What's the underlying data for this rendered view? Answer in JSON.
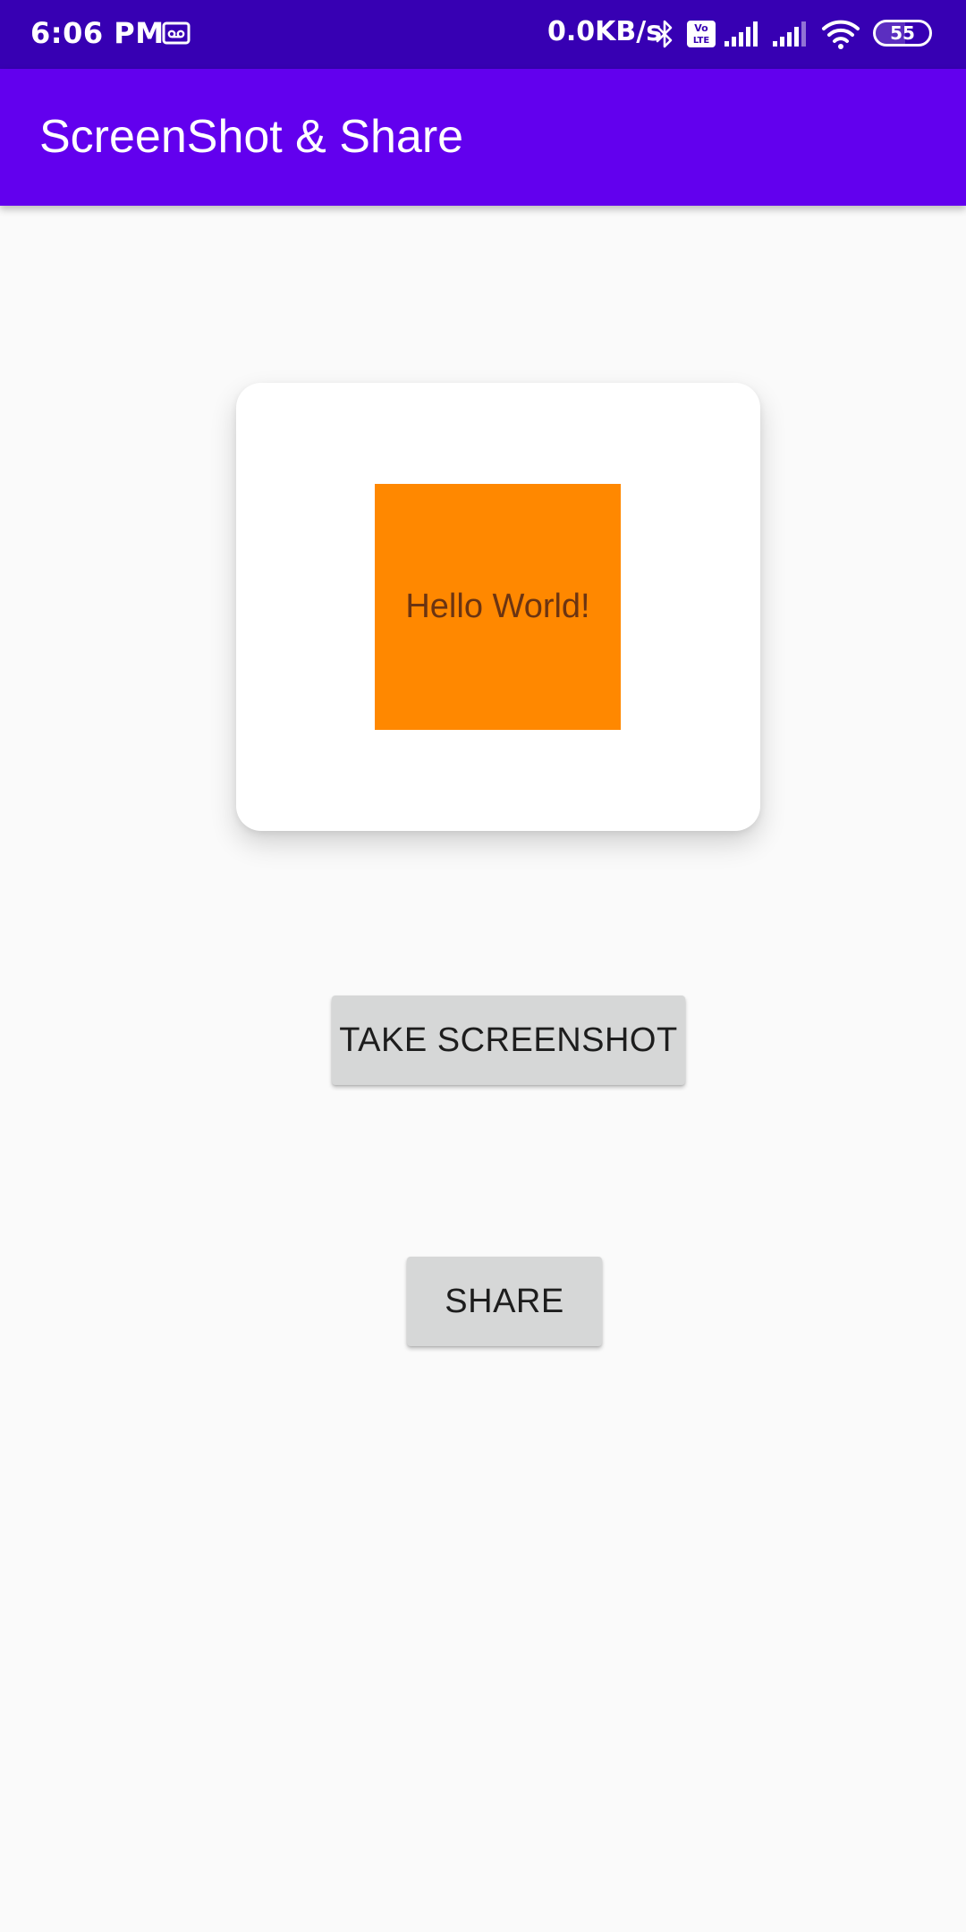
{
  "status_bar": {
    "time": "6:06 PM",
    "network_speed": "0.0KB/s",
    "battery_level": "55",
    "battery_fraction": 0.55,
    "icons": [
      "voicemail-icon",
      "bluetooth-icon",
      "volte-icon",
      "signal-icon",
      "signal-icon",
      "wifi-icon",
      "battery-icon"
    ]
  },
  "app_bar": {
    "title": "ScreenShot & Share"
  },
  "card": {
    "text": "Hello World!"
  },
  "buttons": {
    "take_screenshot": "TAKE SCREENSHOT",
    "share": "SHARE"
  },
  "colors": {
    "status_bar": "#3700b3",
    "app_bar": "#6200ee",
    "orange_box": "#ff8800",
    "button": "#d6d7d7",
    "background": "#fafafa"
  }
}
